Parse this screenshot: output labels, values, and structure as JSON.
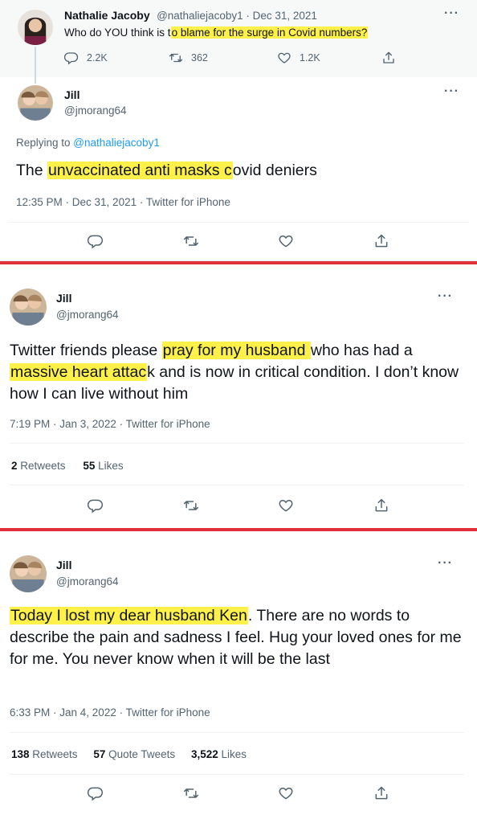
{
  "colors": {
    "highlight": "#fff04a",
    "red_separator": "#e0303a",
    "muted": "#536471",
    "link": "#1d9bf0"
  },
  "panel1": {
    "thread_tweet": {
      "name": "Nathalie Jacoby",
      "handle": "@nathaliejacoby1",
      "dot": " · ",
      "date": "Dec 31, 2021",
      "text_pre": "Who do YOU think is t",
      "text_hl": "o blame for the surge in Covid numbers?",
      "replies": "2.2K",
      "retweets": "362",
      "likes": "1.2K",
      "more": "···"
    },
    "reply": {
      "name": "Jill",
      "handle": "@jmorang64",
      "replying_label": "Replying to ",
      "replying_handle": "@nathaliejacoby1",
      "text_pre": "The ",
      "text_hl": "unvaccinated anti masks c",
      "text_post": "ovid deniers",
      "timestamp": "12:35 PM · Dec 31, 2021 · Twitter for iPhone",
      "more": "···"
    }
  },
  "panel2": {
    "name": "Jill",
    "handle": "@jmorang64",
    "text_1": "Twitter friends please ",
    "text_hl1": "pray for my husband ",
    "text_2": "who has had a ",
    "text_hl2": "massive heart attac",
    "text_3": "k and is now in critical condition. I don’t know how I can live without him",
    "timestamp": "7:19 PM · Jan 3, 2022 · Twitter for iPhone",
    "retweets_count": "2",
    "retweets_label": " Retweets",
    "likes_count": "55",
    "likes_label": " Likes",
    "more": "···"
  },
  "panel3": {
    "name": "Jill",
    "handle": "@jmorang64",
    "text_hl": "Today I lost my dear husband Ken",
    "text_post": ". There are no words to describe the pain and sadness I feel. Hug your loved ones for me for me. You never know when it will be the last",
    "timestamp": "6:33 PM · Jan 4, 2022 · Twitter for iPhone",
    "retweets_count": "138",
    "retweets_label": " Retweets",
    "quotes_count": "57",
    "quotes_label": " Quote Tweets",
    "likes_count": "3,522",
    "likes_label": " Likes",
    "more": "···"
  },
  "icons": [
    "reply-icon",
    "retweet-icon",
    "like-icon",
    "share-icon",
    "more-icon"
  ]
}
